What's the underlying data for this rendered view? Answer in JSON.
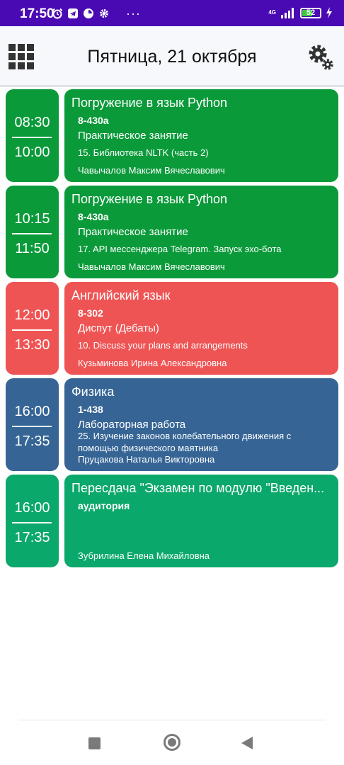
{
  "status_bar": {
    "time": "17:50",
    "network": "4G",
    "battery": "52"
  },
  "header": {
    "title": "Пятница, 21 октября"
  },
  "lessons": [
    {
      "start": "08:30",
      "end": "10:00",
      "subject": "Погружение в язык Python",
      "room": "8-430а",
      "kind": "Практическое занятие",
      "topic": "15. Библиотека NLTK (часть 2)",
      "teacher": "Чавычалов Максим Вячеславович",
      "color": "#0b9a3a"
    },
    {
      "start": "10:15",
      "end": "11:50",
      "subject": "Погружение в язык Python",
      "room": "8-430а",
      "kind": "Практическое занятие",
      "topic": "17. API мессенджера Telegram. Запуск эхо-бота",
      "teacher": "Чавычалов Максим Вячеславович",
      "color": "#0b9a3a"
    },
    {
      "start": "12:00",
      "end": "13:30",
      "subject": "Английский язык",
      "room": "8-302",
      "kind": "Диспут (Дебаты)",
      "topic": "10. Discuss your plans and arrangements",
      "teacher": "Кузьминова Ирина Александровна",
      "color": "#ef5454"
    },
    {
      "start": "16:00",
      "end": "17:35",
      "subject": "Физика",
      "room": "1-438",
      "kind": "Лабораторная работа",
      "topic": "25. Изучение законов колебательного движения с помощью физического маятника",
      "teacher": "Пруцакова Наталья Викторовна",
      "color": "#366595"
    },
    {
      "start": "16:00",
      "end": "17:35",
      "subject": "Пересдача \"Экзамен по модулю \"Введен...",
      "room": "аудитория",
      "kind": "",
      "topic": "",
      "teacher": "Зубрилина Елена Михайловна",
      "color": "#0aa86a"
    }
  ],
  "icons": {
    "menu": "grid-icon",
    "settings": "gears-icon",
    "nav_recents": "square-icon",
    "nav_home": "circle-icon",
    "nav_back": "triangle-back-icon"
  }
}
